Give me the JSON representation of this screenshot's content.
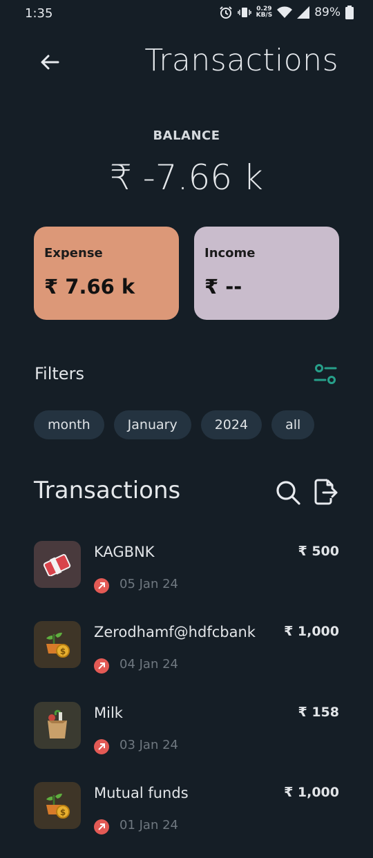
{
  "status_bar": {
    "time": "1:35",
    "speed_top": "0.29",
    "speed_bottom": "KB/S",
    "battery": "89%"
  },
  "header": {
    "title": "Transactions"
  },
  "balance": {
    "label": "BALANCE",
    "value": "₹ -7.66 k"
  },
  "cards": {
    "expense_label": "Expense",
    "expense_value": "₹  7.66 k",
    "income_label": "Income",
    "income_value": "₹  --"
  },
  "filters": {
    "label": "Filters",
    "chips": [
      "month",
      "January",
      "2024",
      "all"
    ]
  },
  "transactions": {
    "heading": "Transactions",
    "items": [
      {
        "name": "KAGBNK",
        "amount": "₹ 500",
        "date": "05 Jan 24",
        "icon": "cash-icon"
      },
      {
        "name": "Zerodhamf@hdfcbank",
        "amount": "₹ 1,000",
        "date": "04 Jan 24",
        "icon": "investment-plant-icon"
      },
      {
        "name": "Milk",
        "amount": "₹ 158",
        "date": "03 Jan 24",
        "icon": "grocery-bag-icon"
      },
      {
        "name": "Mutual funds",
        "amount": "₹ 1,000",
        "date": "01 Jan 24",
        "icon": "investment-plant-icon"
      }
    ]
  },
  "colors": {
    "background": "#151e26",
    "expense_card": "#dc9878",
    "income_card": "#c9bccc",
    "accent_teal": "#27a08a",
    "outgoing_red": "#e35a55"
  }
}
